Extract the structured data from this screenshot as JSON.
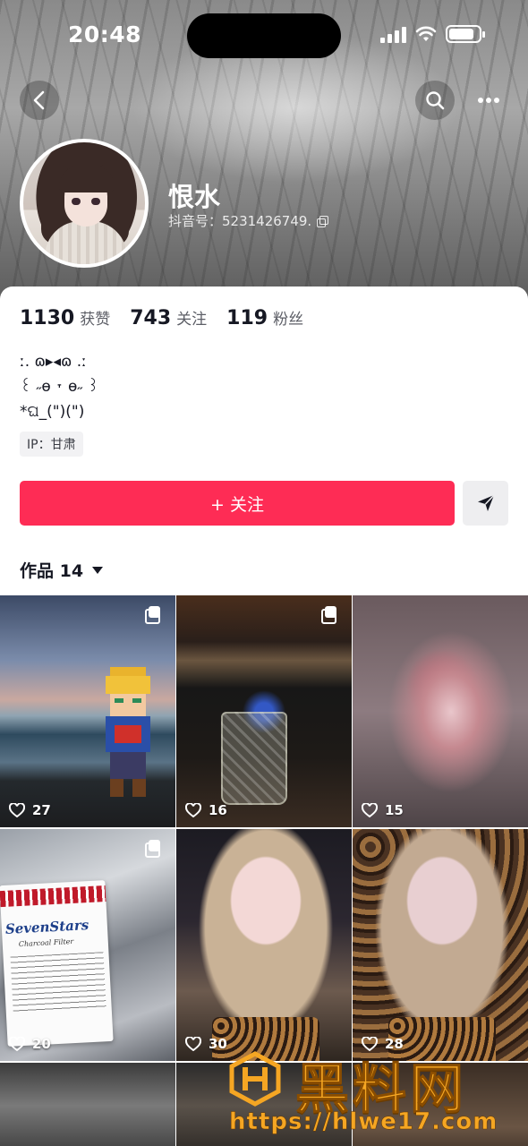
{
  "status_bar": {
    "time": "20:48",
    "battery_level": 0.85
  },
  "header": {
    "username": "恨水",
    "douyin_id": "抖音号：5231426749."
  },
  "stats": [
    {
      "value": "1130",
      "label": "获赞"
    },
    {
      "value": "743",
      "label": "关注"
    },
    {
      "value": "119",
      "label": "粉丝"
    }
  ],
  "bio": {
    "line1": "ː. ɷ▸◂ɷ .ː",
    "line2": "꒰ ˶ɵ ˕ ɵ˶ ꒱",
    "line3": "*ଘ_(\")(\")"
  },
  "ip_label": "IP：甘肃",
  "follow_label": "+ 关注",
  "works_tab": "作品 14",
  "posts": [
    {
      "likes": "27",
      "multi": true
    },
    {
      "likes": "16",
      "multi": true
    },
    {
      "likes": "15",
      "multi": false
    },
    {
      "likes": "20",
      "multi": true,
      "pack_brand": "SevenStars",
      "pack_sub": "Charcoal Filter"
    },
    {
      "likes": "30",
      "multi": false
    },
    {
      "likes": "28",
      "multi": false
    }
  ],
  "watermark": {
    "text": "黑料网",
    "url": "https://hlwe17.com"
  },
  "colors": {
    "accent": "#fe2c55",
    "watermark": "#f5a623"
  }
}
